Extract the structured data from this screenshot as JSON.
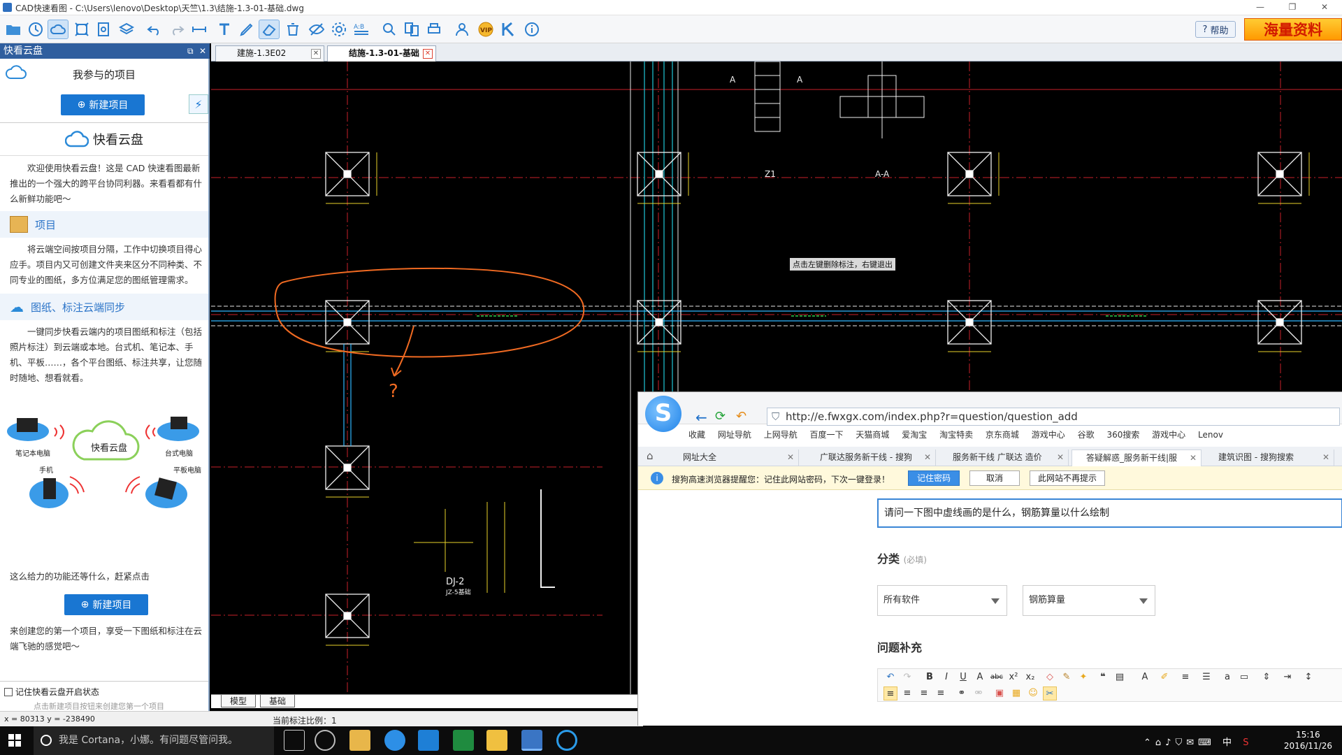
{
  "window": {
    "title": "CAD快速看图 - C:\\Users\\lenovo\\Desktop\\天竺\\1.3\\结施-1.3-01-基础.dwg",
    "minimize_icon": "minimize-icon",
    "maximize_icon": "maximize-icon",
    "close_icon": "close-icon"
  },
  "toolbar": {
    "help_label": "帮助",
    "promo_label": "海量资料",
    "vip_label": "VIP"
  },
  "left_panel": {
    "header": "快看云盘",
    "my_projects": "我参与的项目",
    "new_project": "新建项目",
    "brand": "快看云盘",
    "intro": "欢迎使用快看云盘！这是 CAD 快速看图最新推出的一个强大的跨平台协同利器。来看看都有什么新鲜功能吧～",
    "project_title": "项目",
    "project_text": "将云端空间按项目分隔，工作中切换项目得心应手。项目内又可创建文件夹来区分不同种类、不同专业的图纸，多方位满足您的图纸管理需求。",
    "sync_title": "图纸、标注云端同步",
    "sync_text": "一键同步快看云端内的项目图纸和标注（包括照片标注）到云端或本地。台式机、笔记本、手机、平板……，各个平台图纸、标注共享，让您随时随地、想看就看。",
    "devices": {
      "laptop": "笔记本电脑",
      "cloud": "快看云盘",
      "desktop": "台式电脑",
      "phone": "手机",
      "tablet": "平板电脑"
    },
    "cta_text": "这么给力的功能还等什么，赶紧点击",
    "cta_button": "新建项目",
    "footer_text": "来创建您的第一个项目，享受一下图纸和标注在云端飞驰的感觉吧～",
    "remember_label": "记住快看云盘开启状态",
    "hint": "点击新建项目按钮来创建您第一个项目"
  },
  "tabs": [
    {
      "label": "建施-1.3E02"
    },
    {
      "label": "结施-1.3-01-基础"
    }
  ],
  "cad": {
    "section_A1": "A",
    "section_A2": "A",
    "z1_label": "Z1",
    "aa_label": "A-A",
    "dj_label": "DJ-2",
    "dj_sub": "JZ-5基础",
    "question_mark": "?",
    "tooltip": "点击左键删除标注，右键退出"
  },
  "layout_tabs": [
    "模型",
    "基础"
  ],
  "status": {
    "coords": "x = 80313  y = -238490",
    "scale": "当前标注比例：1"
  },
  "browser": {
    "logo": "S",
    "url": "http://e.fwxgx.com/index.php?r=question/question_add",
    "bookmarks": [
      "收藏",
      "网址导航",
      "上网导航",
      "百度一下",
      "天猫商城",
      "爱淘宝",
      "淘宝特卖",
      "京东商城",
      "游戏中心",
      "谷歌",
      "360搜索",
      "游戏中心",
      "Lenov"
    ],
    "tabs": [
      {
        "label": "网址大全"
      },
      {
        "label": "广联达服务新干线 - 搜狗"
      },
      {
        "label": "服务新干线 广联达 造价"
      },
      {
        "label": "答疑解惑_服务新干线|服"
      },
      {
        "label": "建筑识图 - 搜狗搜索"
      }
    ],
    "pw_text": "搜狗高速浏览器提醒您：记住此网站密码，下次一键登录！",
    "pw_remember": "记住密码",
    "pw_cancel": "取消",
    "pw_never": "此网站不再提示",
    "question": "请问一下图中虚线画的是什么，钢筋算量以什么绘制",
    "category_label": "分类",
    "category_required": "(必填)",
    "select1": "所有软件",
    "select2": "钢筋算量",
    "supplement_label": "问题补充"
  },
  "taskbar": {
    "cortana": "我是 Cortana，小娜。有问题尽管问我。",
    "time": "15:16",
    "date": "2016/11/26",
    "ime": "中"
  }
}
